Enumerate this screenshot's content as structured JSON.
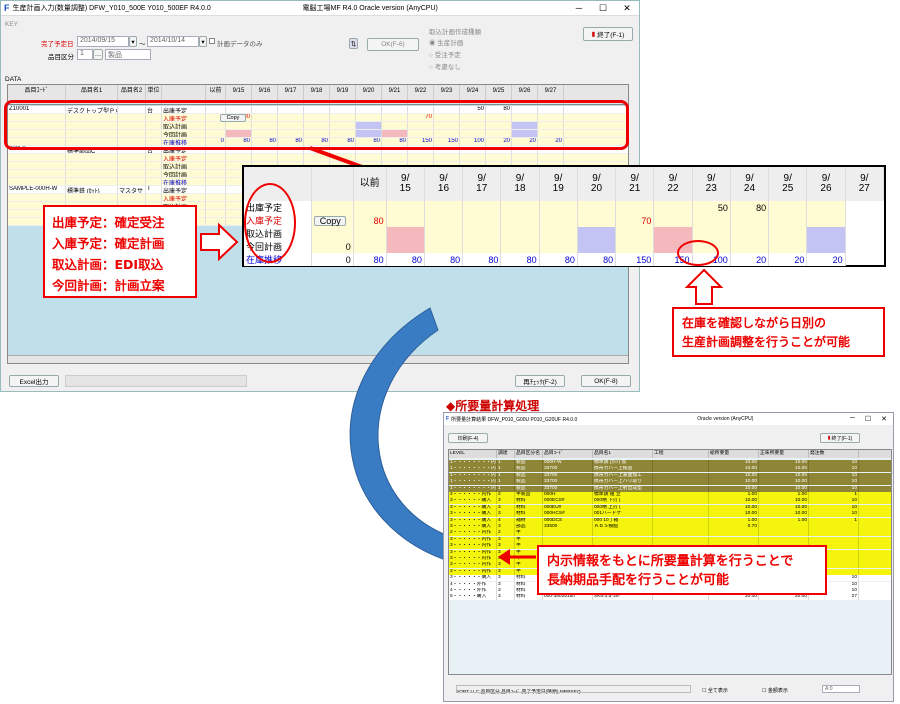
{
  "win1": {
    "app_icon": "F",
    "title": "生産計画入力(数量調整)  DFW_Y010_500E  Y010_500EF  R4.0.0",
    "plant": "電脳工場MF  R4.0  Oracle version (AnyCPU)",
    "minimize": "─",
    "maximize": "☐",
    "close": "✕",
    "key_label": "KEY",
    "due_label": "完了予定日",
    "date_from": "2014/09/15",
    "tilde": "～",
    "date_to": "2014/10/14",
    "plan_only_label": "計画データのみ",
    "item_class_label": "品目区分",
    "item_class_code": "1",
    "item_class_name": "製品",
    "ok_btn": "OK(F-6)",
    "exit_btn": "終了(F-1)",
    "order_group_label": "取込計画作成種類",
    "radio_options": [
      "生産計画",
      "受注予定",
      "考慮なし"
    ],
    "data_label": "DATA",
    "columns": [
      "品目ｺｰﾄﾞ",
      "品目名1",
      "品目名2",
      "単位",
      "",
      "以前",
      "9/15",
      "9/16",
      "9/17",
      "9/18",
      "9/19",
      "9/20",
      "9/21",
      "9/22",
      "9/23",
      "9/24",
      "9/25",
      "9/26",
      "9/27"
    ],
    "row_labels": [
      "出庫予定",
      "入庫予定",
      "取込計画",
      "今回計画",
      "在庫推移"
    ],
    "item1": {
      "code": "Z10001",
      "name1": "デスクトップ型ＰＣハイスペ",
      "unit": "台"
    },
    "item2": {
      "code": "33950",
      "name1": "標準部品C",
      "unit": "台"
    },
    "item3": {
      "code": "SAMPLE-000H-W",
      "name1": "標準鉄 (ｶｯﾄ)",
      "name2": "マスタサ",
      "unit": "T"
    },
    "copy_btn": "Copy",
    "zero": "0",
    "excel_btn": "Excel出力",
    "recalc_btn": "再ﾁｪｯｸ(F-2)",
    "ok2_btn": "OK(F-8)"
  },
  "zoom": {
    "columns": [
      "",
      "",
      "以前",
      "9/\n15",
      "9/\n16",
      "9/\n17",
      "9/\n18",
      "9/\n19",
      "9/\n20",
      "9/\n21",
      "9/\n22",
      "9/\n23",
      "9/\n24",
      "9/\n25",
      "9/\n26",
      "9/\n27"
    ],
    "rows": [
      {
        "label": "出庫予定",
        "copy": "",
        "vals": [
          "",
          "",
          "",
          "",
          "",
          "",
          "",
          "",
          "",
          "50",
          "80",
          "",
          ""
        ]
      },
      {
        "label": "入庫予定",
        "copy": "Copy",
        "vals": [
          "80",
          "",
          "",
          "",
          "",
          "",
          "",
          "70",
          "",
          "",
          "",
          "",
          ""
        ]
      },
      {
        "label": "取込計画",
        "copy": "",
        "vals": [
          "",
          "",
          "",
          "",
          "",
          "",
          "",
          "",
          "",
          "",
          "",
          "",
          ""
        ]
      },
      {
        "label": "今回計画",
        "copy": "0",
        "vals": [
          "",
          "",
          "",
          "",
          "",
          "",
          "",
          "",
          "",
          "",
          "",
          "",
          ""
        ]
      },
      {
        "label": "在庫推移",
        "copy": "0",
        "vals": [
          "80",
          "80",
          "80",
          "80",
          "80",
          "80",
          "80",
          "150",
          "150",
          "100",
          "20",
          "20",
          "20"
        ]
      }
    ]
  },
  "callout1": {
    "lines": [
      "出庫予定：確定受注",
      "入庫予定：確定計画",
      "取込計画：EDI取込",
      "今回計画：計画立案"
    ]
  },
  "callout2": {
    "lines": [
      "在庫を確認しながら日別の",
      "生産計画調整を行うことが可能"
    ]
  },
  "section2_title": "◆所要量計算処理",
  "win2": {
    "title": "所要量計算結果  DFW_P010_G00U  P010_G20UF  R4.0.0",
    "version": "Oracle version (AnyCPU)",
    "print_btn": "印刷(F-4)",
    "exit_btn": "終了(F-1)",
    "columns": [
      "LEVEL",
      "調達",
      "品目区分名",
      "品目ｺｰﾄﾞ",
      "品目名1",
      "工程",
      "総所要量",
      "正味所要量",
      "発注数"
    ],
    "rows": [
      {
        "c": "olive",
        "v": [
          "1・・・・・・・・内作",
          "1",
          "製品",
          "000H-W",
          "標準鉄 (ｶｯﾄ) 仮",
          "",
          "10.00",
          "10.00",
          "10"
        ]
      },
      {
        "c": "olive",
        "v": [
          "1・・・・・・・・内作",
          "1",
          "製品",
          "33700",
          "携帯カバー上検査",
          "",
          "10.00",
          "10.00",
          "10"
        ]
      },
      {
        "c": "olive",
        "v": [
          "1・・・・・・・・内作",
          "1",
          "製品",
          "33700",
          "携帯カバー上表面加工",
          "",
          "10.00",
          "10.00",
          "10"
        ]
      },
      {
        "c": "olive",
        "v": [
          "1・・・・・・・・内作",
          "1",
          "製品",
          "33700",
          "携帯カバー上バリ取り",
          "",
          "10.00",
          "10.00",
          "10"
        ]
      },
      {
        "c": "olive",
        "v": [
          "1・・・・・・・・内作",
          "1",
          "製品",
          "33700",
          "携帯カバー上射出成型",
          "",
          "10.00",
          "10.00",
          "10"
        ]
      },
      {
        "c": "yel",
        "v": [
          "2・・・・・・内作",
          "2",
          "半製品",
          "000H",
          "標準鉄    組  立",
          "",
          "1.00",
          "1.00",
          "1"
        ]
      },
      {
        "c": "yel",
        "v": [
          "3・・・・・・購入",
          "3",
          "材料",
          "000ECS#",
          "000柄 下刃 (",
          "",
          "10.00",
          "10.00",
          "10"
        ]
      },
      {
        "c": "yel",
        "v": [
          "3・・・・・・購入",
          "3",
          "材料",
          "000EU#",
          "000柄 上刃 (",
          "",
          "10.00",
          "10.00",
          "10"
        ]
      },
      {
        "c": "yel",
        "v": [
          "3・・・・・・購入",
          "3",
          "材料",
          "000HCS#",
          "001ハードケ",
          "",
          "10.00",
          "10.00",
          "10"
        ]
      },
      {
        "c": "yel",
        "v": [
          "3・・・・・・購入",
          "4",
          "補材",
          "000DCS",
          "000 10丁箱",
          "",
          "1.00",
          "1.00",
          "1"
        ]
      },
      {
        "c": "yel",
        "v": [
          "3・・・・・・購入",
          "3",
          "部品",
          "33500",
          "ＡＢＳ樹脂",
          "",
          "0.70",
          "",
          ""
        ]
      },
      {
        "c": "yel",
        "v": [
          "2・・・・・・内作",
          "2",
          "半",
          "",
          "",
          "",
          "",
          "",
          ""
        ]
      },
      {
        "c": "yel",
        "v": [
          "3・・・・・・内作",
          "3",
          "半",
          "",
          "",
          "",
          "",
          "",
          ""
        ]
      },
      {
        "c": "yel",
        "v": [
          "3・・・・・・内作",
          "3",
          "半",
          "",
          "",
          "",
          "",
          "",
          ""
        ]
      },
      {
        "c": "yel",
        "v": [
          "3・・・・・・内作",
          "3",
          "半",
          "",
          "",
          "",
          "",
          "",
          ""
        ]
      },
      {
        "c": "yel",
        "v": [
          "3・・・・・・内作",
          "3",
          "半",
          "",
          "",
          "",
          "",
          "",
          ""
        ]
      },
      {
        "c": "yel",
        "v": [
          "3・・・・・・内作",
          "3",
          "半",
          "",
          "",
          "",
          "",
          "",
          ""
        ]
      },
      {
        "c": "yel",
        "v": [
          "3・・・・・・内作",
          "3",
          "半",
          "",
          "",
          "",
          "",
          "",
          ""
        ]
      },
      {
        "c": "wht",
        "v": [
          "3・・・・・・購入",
          "3",
          "材料",
          "000-NE-W6140",
          "ｾﾝﾀｰﾅｯﾄﾞ W6*1",
          "",
          "10.00",
          "10.00",
          "10"
        ]
      },
      {
        "c": "wht",
        "v": [
          "4・・・・・外作",
          "3",
          "材料",
          "000HS",
          "標準鉄下刃",
          "プレス",
          "10.00",
          "10.00",
          "10"
        ]
      },
      {
        "c": "wht",
        "v": [
          "4・・・・・外作",
          "3",
          "材料",
          "000HU",
          "標準鉄上刃",
          "プレス",
          "10.00",
          "10.00",
          "10"
        ]
      },
      {
        "c": "wht",
        "v": [
          "5・・・・・購入",
          "3",
          "材料",
          "000-35025150",
          "SK5-3.5*25*",
          "",
          "20.00",
          "20.00",
          "27"
        ]
      }
    ],
    "sort_text": "SORT LLC,品目区分,品目ｺｰﾄﾞ,完了予定日(降順),MRPSEQ",
    "show_all": "全て表示",
    "amount_show": "金額表示",
    "page_a": "A:0"
  },
  "callout3": {
    "lines": [
      "内示情報をもとに所要量計算を行うことで",
      "長納期品手配を行うことが可能"
    ]
  },
  "colors": {
    "red": "#e00000",
    "arrow_blue": "#3a7cc4",
    "olive": "#8e8536",
    "yellow": "#f4f40c"
  }
}
